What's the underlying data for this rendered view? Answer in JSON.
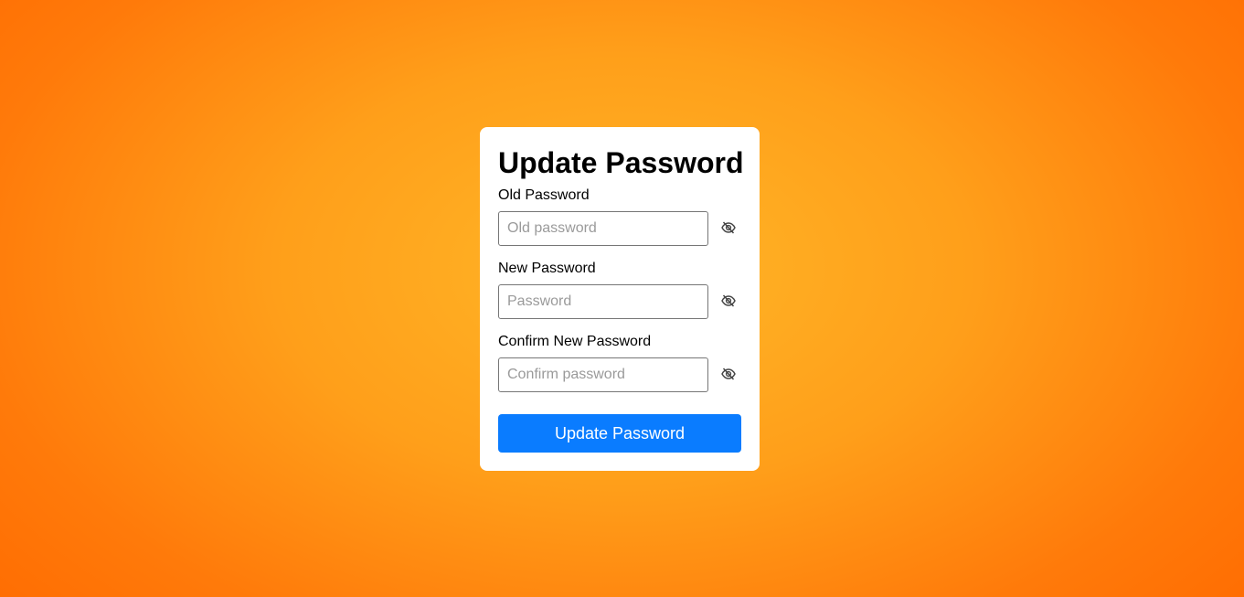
{
  "form": {
    "title": "Update Password",
    "fields": [
      {
        "label": "Old Password",
        "placeholder": "Old password",
        "value": "",
        "icon": "eye-slash-icon"
      },
      {
        "label": "New Password",
        "placeholder": "Password",
        "value": "",
        "icon": "eye-slash-icon"
      },
      {
        "label": "Confirm New Password",
        "placeholder": "Confirm password",
        "value": "",
        "icon": "eye-slash-icon"
      }
    ],
    "submit_label": "Update Password"
  },
  "colors": {
    "background_center": "#ffb627",
    "background_edge": "#ff6a00",
    "card": "#ffffff",
    "button": "#0a7cff",
    "button_text": "#ffffff"
  }
}
